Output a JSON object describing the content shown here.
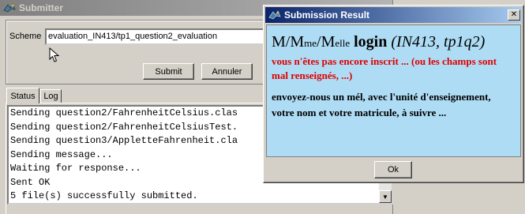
{
  "submitter": {
    "title": "Submitter",
    "scheme_label": "Scheme",
    "scheme_value": "evaluation_IN413/tp1_question2_evaluation",
    "submit_label": "Submit",
    "cancel_label": "Annuler",
    "tabs": [
      {
        "label": "Status"
      },
      {
        "label": "Log"
      }
    ],
    "console_lines": [
      "Sending question2/FahrenheitCelsius.clas",
      "Sending question2/FahrenheitCelsiusTest.",
      "Sending question3/AppletteFahrenheit.cla",
      "Sending message...",
      "Waiting for response...",
      "Sent OK",
      "5 file(s) successfully submitted."
    ]
  },
  "dialog": {
    "title": "Submission Result",
    "heading_1": "M/M",
    "heading_2": "me",
    "heading_3": "/M",
    "heading_4": "elle",
    "heading_5": " login ",
    "heading_6": "(IN413, tp1q2)",
    "warning": " vous n'êtes pas encore inscrit ... (ou les champs sont mal renseignés, ...)",
    "instructions": "envoyez-nous un mél, avec l'unité d'enseignement, votre nom et votre matricule, à suivre ...",
    "ok_label": "Ok"
  },
  "icons": [
    "app-icon",
    "close-icon",
    "scroll-up-icon",
    "scroll-down-icon",
    "mouse-cursor-icon"
  ],
  "colors": {
    "dialog_body": "#aedcf5",
    "warning_text": "#e00000",
    "active_title": "#0a246a"
  }
}
